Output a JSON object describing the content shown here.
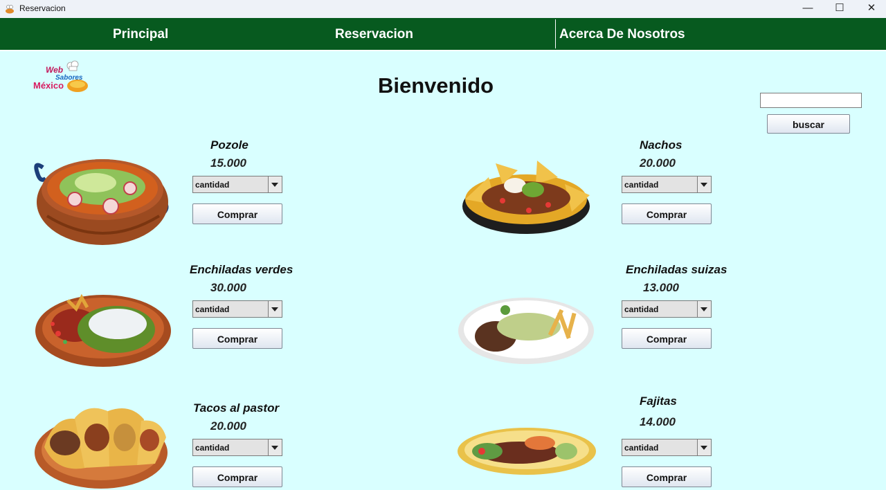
{
  "window": {
    "title": "Reservacion",
    "min_glyph": "—",
    "max_glyph": "☐",
    "close_glyph": "✕"
  },
  "nav": {
    "items": [
      {
        "label": "Principal"
      },
      {
        "label": "Reservacion"
      },
      {
        "label": "Acerca De Nosotros"
      }
    ]
  },
  "logo": {
    "line1": "Web",
    "line2": "Sabores",
    "line3": "México"
  },
  "main": {
    "title": "Bienvenido"
  },
  "search": {
    "value": "",
    "button_label": "buscar"
  },
  "products": [
    {
      "name": "Pozole",
      "price": "15.000",
      "select_value": "cantidad",
      "button_label": "Comprar"
    },
    {
      "name": "Nachos",
      "price": "20.000",
      "select_value": "cantidad",
      "button_label": "Comprar"
    },
    {
      "name": "Enchiladas verdes",
      "price": "30.000",
      "select_value": "cantidad",
      "button_label": "Comprar"
    },
    {
      "name": "Enchiladas suizas",
      "price": "13.000",
      "select_value": "cantidad",
      "button_label": "Comprar"
    },
    {
      "name": "Tacos al pastor",
      "price": "20.000",
      "select_value": "cantidad",
      "button_label": "Comprar"
    },
    {
      "name": "Fajitas",
      "price": "14.000",
      "select_value": "cantidad",
      "button_label": "Comprar"
    }
  ],
  "colors": {
    "nav_bg": "#075a1f",
    "page_bg": "#d9ffff",
    "nav_text": "#ffffff"
  }
}
